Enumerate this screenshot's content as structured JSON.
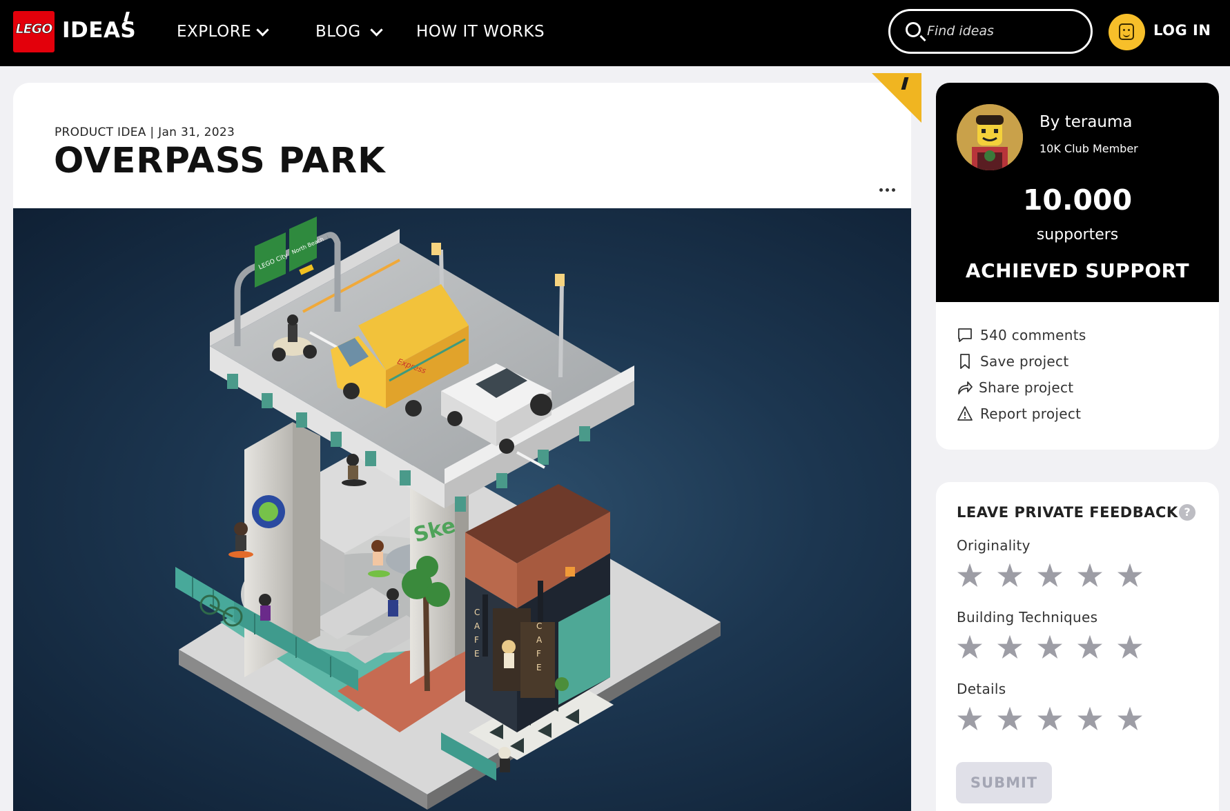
{
  "nav": {
    "logo_text": "LEGO",
    "brand": "IDEAS",
    "items": [
      {
        "label": "EXPLORE",
        "has_dropdown": true
      },
      {
        "label": "BLOG",
        "has_dropdown": true
      },
      {
        "label": "HOW IT WORKS",
        "has_dropdown": false
      }
    ],
    "search_placeholder": "Find ideas",
    "login_label": "LOG IN"
  },
  "project": {
    "meta": "PRODUCT IDEA | Jan 31, 2023",
    "title": "OVERPASS PARK",
    "image_signs": [
      "LEGO City",
      "North Beach"
    ],
    "image_truck_text": "Express",
    "image_cafe_text": "CAFE"
  },
  "support": {
    "by_label": "By terauma",
    "club": "10K Club Member",
    "count": "10.000",
    "supporters_label": "supporters",
    "status": "ACHIEVED SUPPORT"
  },
  "actions": [
    {
      "label": "540 comments",
      "icon": "comment-icon"
    },
    {
      "label": "Save project",
      "icon": "bookmark-icon"
    },
    {
      "label": "Share project",
      "icon": "share-icon"
    },
    {
      "label": "Report project",
      "icon": "warning-icon"
    }
  ],
  "feedback": {
    "title": "LEAVE PRIVATE FEEDBACK",
    "help_icon": "?",
    "criteria": [
      {
        "label": "Originality",
        "rating": 0,
        "max": 5
      },
      {
        "label": "Building Techniques",
        "rating": 0,
        "max": 5
      },
      {
        "label": "Details",
        "rating": 0,
        "max": 5
      }
    ],
    "submit_label": "SUBMIT"
  },
  "colors": {
    "nav_bg": "#000000",
    "lego_red": "#e3000b",
    "accent_yellow": "#f7bf2a",
    "page_bg": "#f1f1f4",
    "star_inactive": "#9d9da5",
    "submit_disabled_bg": "#e0e0e8"
  }
}
